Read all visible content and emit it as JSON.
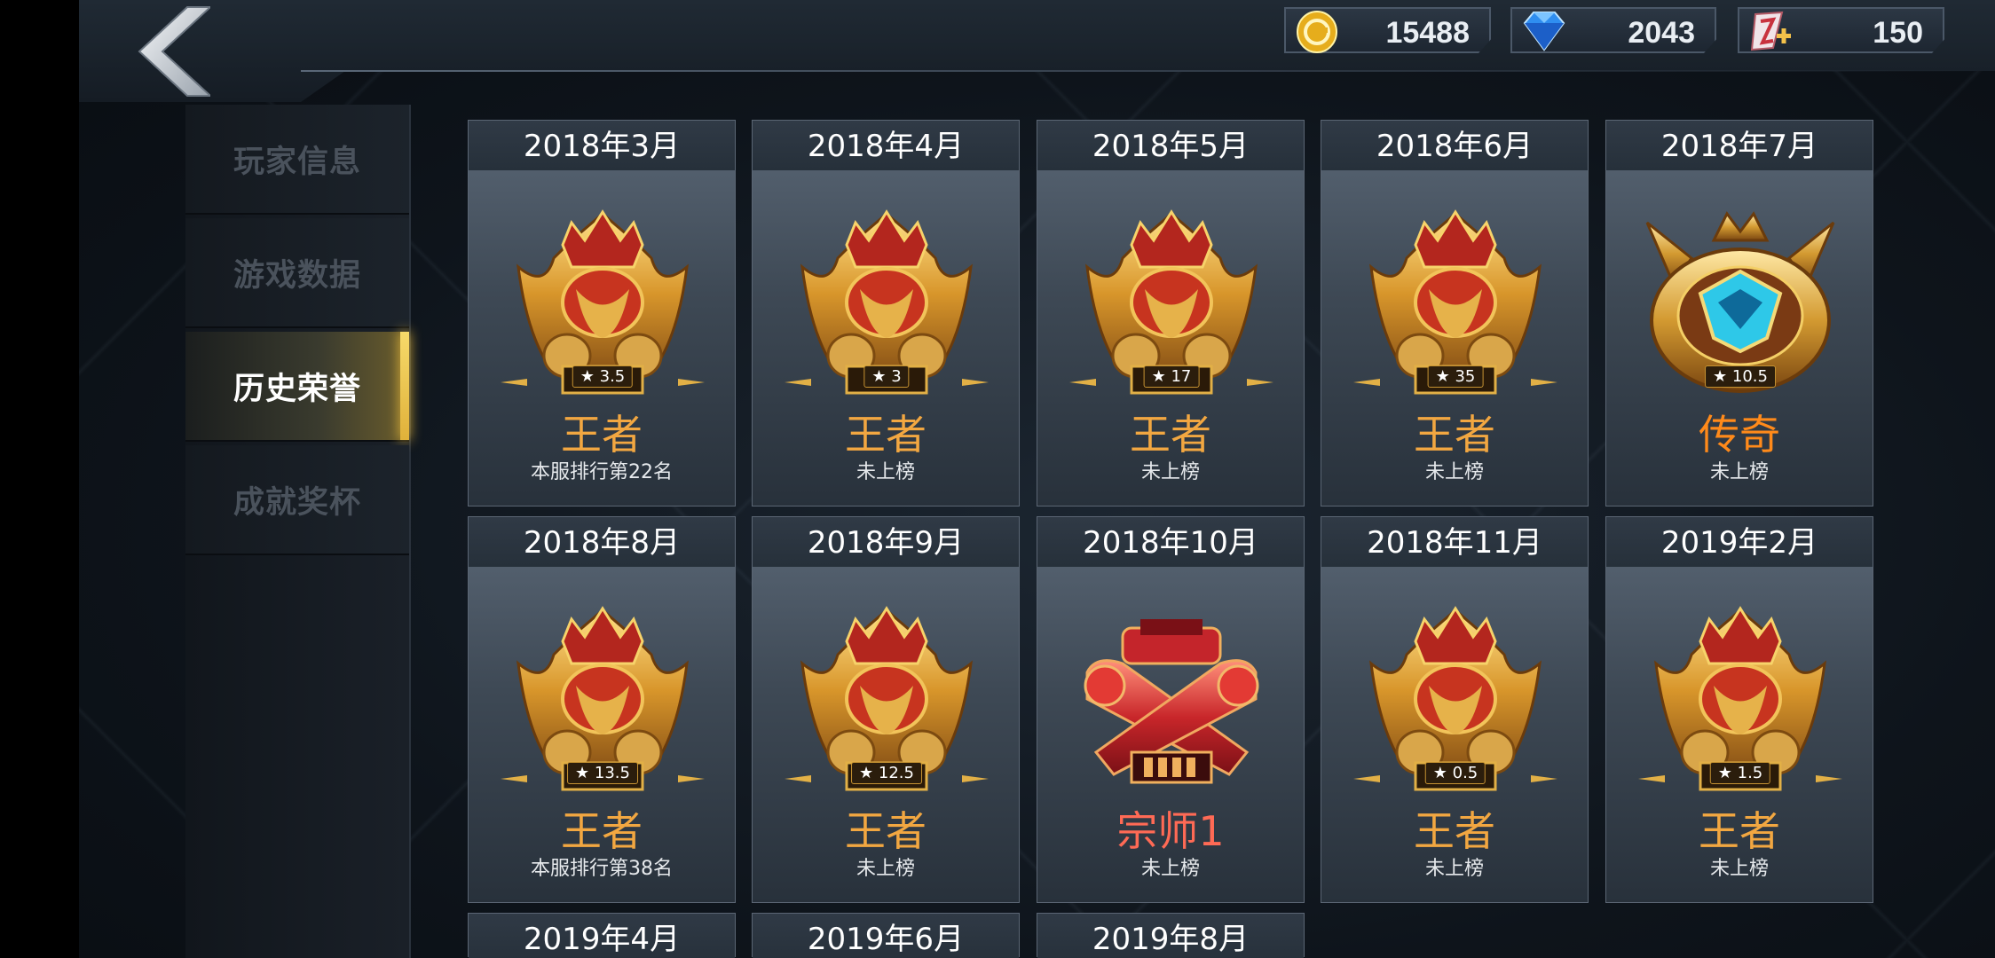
{
  "currencies": [
    {
      "icon": "gold-coin-icon",
      "amount": "15488"
    },
    {
      "icon": "blue-diamond-icon",
      "amount": "2043"
    },
    {
      "icon": "ticket-plus-icon",
      "amount": "150"
    }
  ],
  "sidebar": {
    "items": [
      {
        "label": "玩家信息",
        "active": false
      },
      {
        "label": "游戏数据",
        "active": false
      },
      {
        "label": "历史荣誉",
        "active": true
      },
      {
        "label": "成就奖杯",
        "active": false
      }
    ]
  },
  "honors": [
    {
      "month": "2018年3月",
      "rank": "王者",
      "stars": "3.5",
      "standing": "本服排行第22名",
      "badge": "king-crown-badge-icon"
    },
    {
      "month": "2018年4月",
      "rank": "王者",
      "stars": "3",
      "standing": "未上榜",
      "badge": "king-crown-badge-icon"
    },
    {
      "month": "2018年5月",
      "rank": "王者",
      "stars": "17",
      "standing": "未上榜",
      "badge": "king-crown-badge-icon"
    },
    {
      "month": "2018年6月",
      "rank": "王者",
      "stars": "35",
      "standing": "未上榜",
      "badge": "king-crown-badge-icon"
    },
    {
      "month": "2018年7月",
      "rank": "传奇",
      "stars": "10.5",
      "standing": "未上榜",
      "badge": "legend-wing-badge-icon"
    },
    {
      "month": "2018年8月",
      "rank": "王者",
      "stars": "13.5",
      "standing": "本服排行第38名",
      "badge": "king-crown-badge-icon"
    },
    {
      "month": "2018年9月",
      "rank": "王者",
      "stars": "12.5",
      "standing": "未上榜",
      "badge": "king-crown-badge-icon"
    },
    {
      "month": "2018年10月",
      "rank": "宗师1",
      "stars": "",
      "standing": "未上榜",
      "badge": "master-guns-badge-icon"
    },
    {
      "month": "2018年11月",
      "rank": "王者",
      "stars": "0.5",
      "standing": "未上榜",
      "badge": "king-crown-badge-icon"
    },
    {
      "month": "2019年2月",
      "rank": "王者",
      "stars": "1.5",
      "standing": "未上榜",
      "badge": "king-crown-badge-icon"
    },
    {
      "month": "2019年4月"
    },
    {
      "month": "2019年6月"
    },
    {
      "month": "2019年8月"
    }
  ],
  "colors": {
    "king": "#f2a741",
    "legend": "#ff8a1a",
    "master": "#ff6a55",
    "active_tab_accent": "#f7da6a"
  }
}
